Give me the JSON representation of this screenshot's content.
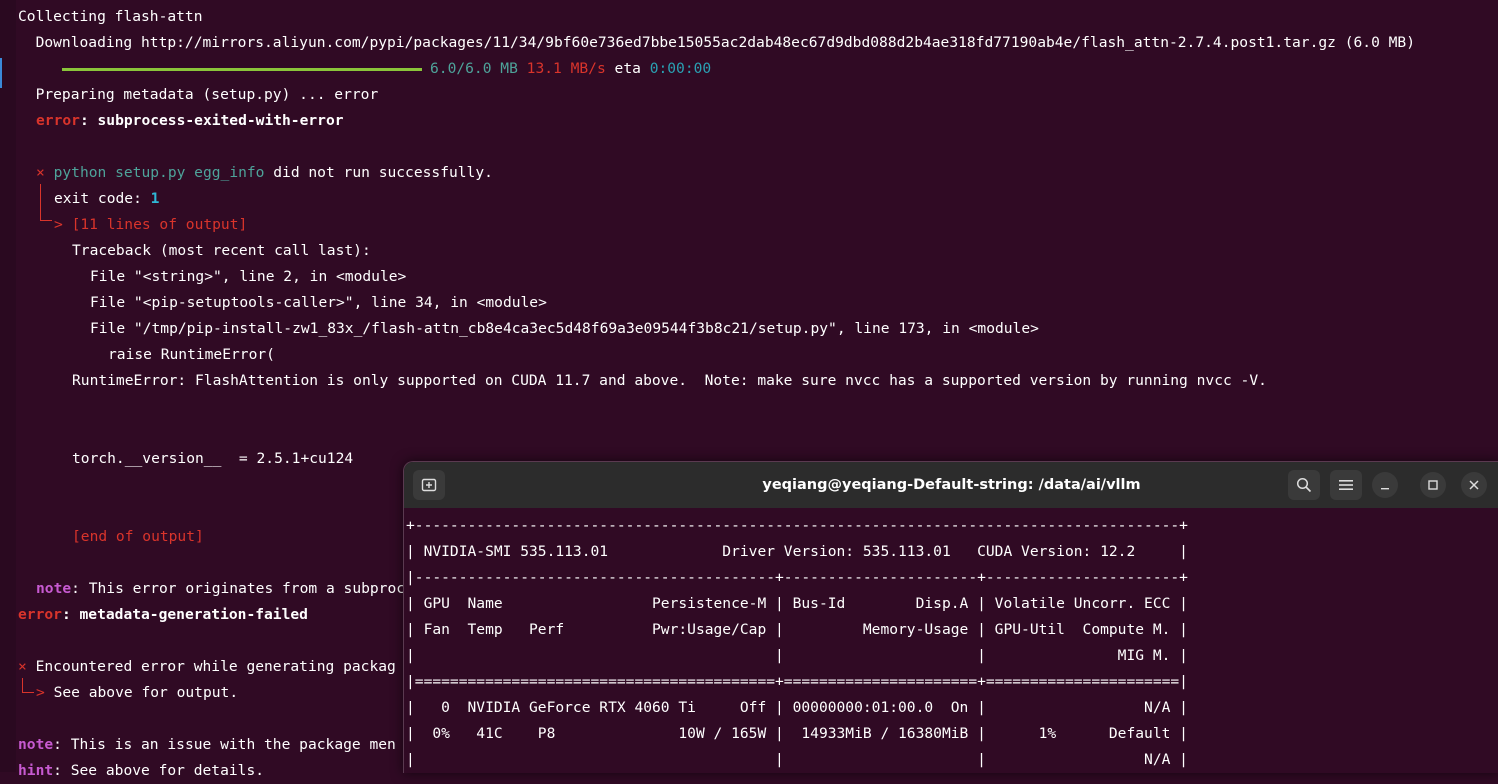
{
  "background_terminal": {
    "collecting": "Collecting flash-attn",
    "downloading": "  Downloading http://mirrors.aliyun.com/pypi/packages/11/34/9bf60e736ed7bbe15055ac2dab48ec67d9dbd088d2b4ae318fd77190ab4e/flash_attn-2.7.4.post1.tar.gz (6.0 MB)",
    "progress": {
      "fraction": 1.0,
      "size": "6.0/6.0 MB",
      "speed": "13.1 MB/s",
      "eta_label": "eta",
      "eta_value": "0:00:00"
    },
    "preparing": "  Preparing metadata (setup.py) ... error",
    "error1_prefix": "error",
    "error1_msg": ": subprocess-exited-with-error",
    "x_glyph": "×",
    "cmd": "python setup.py egg_info",
    "cmd_suffix": " did not run successfully.",
    "exit_label": "exit code: ",
    "exit_value": "1",
    "lines_out": "> [11 lines of output]",
    "tb_header": "Traceback (most recent call last):",
    "tb1": "File \"<string>\", line 2, in <module>",
    "tb2": "File \"<pip-setuptools-caller>\", line 34, in <module>",
    "tb3": "File \"/tmp/pip-install-zw1_83x_/flash-attn_cb8e4ca3ec5d48f69a3e09544f3b8c21/setup.py\", line 173, in <module>",
    "tb4": "raise RuntimeError(",
    "runtime_error": "RuntimeError: FlashAttention is only supported on CUDA 11.7 and above.  Note: make sure nvcc has a supported version by running nvcc -V.",
    "torch_version": "torch.__version__  = 2.5.1+cu124",
    "end_output": "[end of output]",
    "note1_label": "note",
    "note1_text": ": This error originates from a subprocc",
    "error2_prefix": "error",
    "error2_msg": ": metadata-generation-failed",
    "encountered": " Encountered error while generating packag",
    "see_above": "See above for output.",
    "note2_label": "note",
    "note2_text": ": This is an issue with the package men",
    "hint_label": "hint",
    "hint_text": ": See above for details."
  },
  "overlay_window": {
    "title": "yeqiang@yeqiang-Default-string: /data/ai/vllm",
    "icons": {
      "new_tab": "new-tab-icon",
      "search": "search-icon",
      "menu": "hamburger-menu-icon",
      "minimize": "minimize-icon",
      "maximize": "maximize-icon",
      "close": "close-icon"
    },
    "lines": [
      "+---------------------------------------------------------------------------------------+",
      "| NVIDIA-SMI 535.113.01             Driver Version: 535.113.01   CUDA Version: 12.2     |",
      "|-----------------------------------------+----------------------+----------------------+",
      "| GPU  Name                 Persistence-M | Bus-Id        Disp.A | Volatile Uncorr. ECC |",
      "| Fan  Temp   Perf          Pwr:Usage/Cap |         Memory-Usage | GPU-Util  Compute M. |",
      "|                                         |                      |               MIG M. |",
      "|=========================================+======================+======================|",
      "|   0  NVIDIA GeForce RTX 4060 Ti     Off | 00000000:01:00.0  On |                  N/A |",
      "|  0%   41C    P8              10W / 165W |  14933MiB / 16380MiB |      1%      Default |",
      "|                                         |                      |                  N/A |"
    ]
  }
}
